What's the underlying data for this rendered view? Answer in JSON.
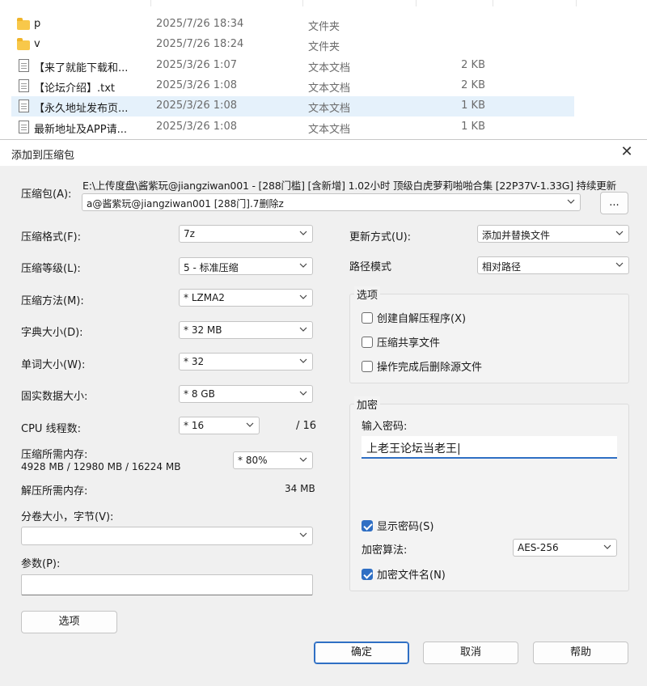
{
  "files": [
    {
      "name": "p",
      "date": "2025/7/26 18:34",
      "type": "文件夹",
      "size": "",
      "kind": "folder",
      "selected": false
    },
    {
      "name": "v",
      "date": "2025/7/26 18:24",
      "type": "文件夹",
      "size": "",
      "kind": "folder",
      "selected": false
    },
    {
      "name": "【来了就能下载和...",
      "date": "2025/3/26 1:07",
      "type": "文本文档",
      "size": "2 KB",
      "kind": "doc",
      "selected": false
    },
    {
      "name": "【论坛介绍】.txt",
      "date": "2025/3/26 1:08",
      "type": "文本文档",
      "size": "2 KB",
      "kind": "doc",
      "selected": false
    },
    {
      "name": "【永久地址发布页...",
      "date": "2025/3/26 1:08",
      "type": "文本文档",
      "size": "1 KB",
      "kind": "doc",
      "selected": true
    },
    {
      "name": "最新地址及APP请...",
      "date": "2025/3/26 1:08",
      "type": "文本文档",
      "size": "1 KB",
      "kind": "doc",
      "selected": false
    }
  ],
  "dialog": {
    "title": "添加到压缩包",
    "close_icon": "✕",
    "archive_label": "压缩包(A):",
    "archive_path": "E:\\上传度盘\\酱紫玩@jiangziwan001 - [288门槛] [含新增] 1.02小时 顶级白虎萝莉啪啪合集 [22P37V-1.33G] 持续更新",
    "archive_name": "a@酱紫玩@jiangziwan001 [288门].7删除z",
    "browse_label": "...",
    "format_label": "压缩格式(F):",
    "format_value": "7z",
    "level_label": "压缩等级(L):",
    "level_value": "5 - 标准压缩",
    "method_label": "压缩方法(M):",
    "method_value": "* LZMA2",
    "dict_label": "字典大小(D):",
    "dict_value": "* 32 MB",
    "word_label": "单词大小(W):",
    "word_value": "* 32",
    "solid_label": "固实数据大小:",
    "solid_value": "* 8 GB",
    "cpu_label": "CPU 线程数:",
    "cpu_value": "* 16",
    "cpu_total": "/ 16",
    "mem_comp_label": "压缩所需内存:",
    "mem_comp_detail": "4928 MB / 12980 MB / 16224 MB",
    "mem_comp_value": "* 80%",
    "mem_decomp_label": "解压所需内存:",
    "mem_decomp_value": "34 MB",
    "split_label": "分卷大小，字节(V):",
    "split_value": "",
    "params_label": "参数(P):",
    "params_value": "",
    "options_button": "选项",
    "update_label": "更新方式(U):",
    "update_value": "添加并替换文件",
    "path_label": "路径模式",
    "path_value": "相对路径",
    "options_group": "选项",
    "opt_sfx": "创建自解压程序(X)",
    "opt_shared": "压缩共享文件",
    "opt_delete": "操作完成后删除源文件",
    "encrypt_group": "加密",
    "password_label": "输入密码:",
    "password_value": "上老王论坛当老王|",
    "show_password": "显示密码(S)",
    "enc_method_label": "加密算法:",
    "enc_method_value": "AES-256",
    "encrypt_names": "加密文件名(N)",
    "ok": "确定",
    "cancel": "取消",
    "help": "帮助"
  },
  "colors": {
    "accent": "#2f6fc4",
    "selection": "#e5f1fb",
    "folder": "#f8c84a"
  }
}
